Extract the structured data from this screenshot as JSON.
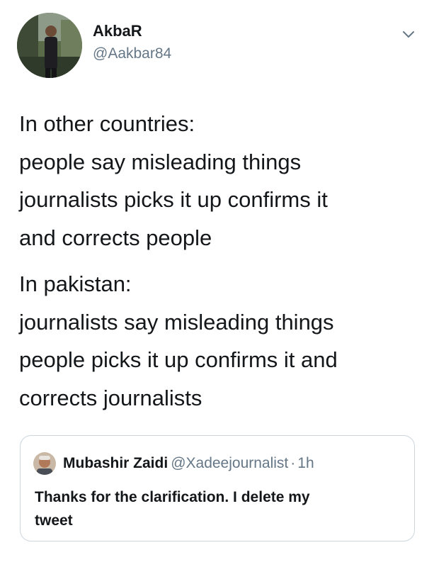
{
  "tweet": {
    "author_name": "AkbaR",
    "author_handle": "@Aakbar84",
    "avatar_icon": "profile-photo-icon",
    "menu_icon": "chevron-down-icon",
    "body_paragraphs": [
      [
        "In other countries:",
        "people say misleading things",
        "journalists picks it up confirms it",
        "and corrects people"
      ],
      [
        "In pakistan:",
        "journalists say misleading things",
        "people picks it up confirms it and",
        "corrects journalists"
      ]
    ]
  },
  "quoted_tweet": {
    "author_name": "Mubashir Zaidi",
    "author_handle": "@Xadeejournalist",
    "separator": "·",
    "time": "1h",
    "avatar_icon": "profile-photo-icon",
    "text_lines": [
      "Thanks for the clarification. I delete my",
      "tweet"
    ]
  },
  "colors": {
    "text_primary": "#14171a",
    "text_secondary": "#657786",
    "border": "#ccd6dd"
  }
}
